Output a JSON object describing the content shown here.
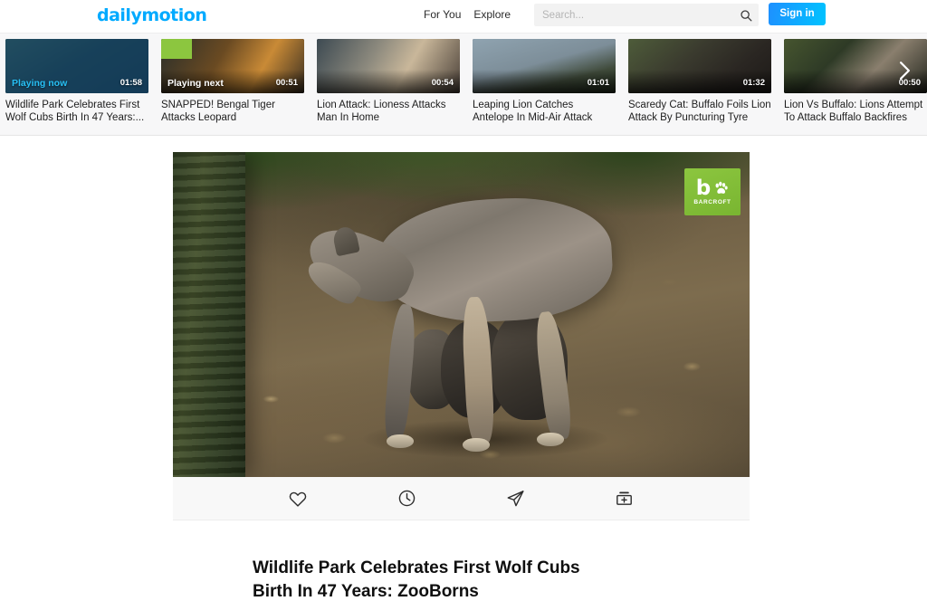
{
  "header": {
    "logo": "dailymotion",
    "nav": [
      {
        "label": "For You",
        "name": "nav-for-you"
      },
      {
        "label": "Explore",
        "name": "nav-explore"
      }
    ],
    "search": {
      "placeholder": "Search...",
      "value": "",
      "icon": "search-icon"
    },
    "signin_label": "Sign in",
    "accent_color": "#00aaff",
    "signin_gradient_from": "#1e90ff",
    "signin_gradient_to": "#00c3ff"
  },
  "strip": {
    "next_arrow_icon": "chevron-right-icon",
    "items": [
      {
        "title": "Wildlife Park Celebrates First Wolf Cubs Birth In 47 Years:...",
        "duration": "01:58",
        "badge": "Playing now",
        "state": "now"
      },
      {
        "title": "SNAPPED! Bengal Tiger Attacks Leopard",
        "duration": "00:51",
        "badge": "Playing next",
        "state": "next"
      },
      {
        "title": "Lion Attack: Lioness Attacks Man In Home",
        "duration": "00:54",
        "badge": "",
        "state": "idle"
      },
      {
        "title": "Leaping Lion Catches Antelope In Mid-Air Attack",
        "duration": "01:01",
        "badge": "",
        "state": "idle"
      },
      {
        "title": "Scaredy Cat: Buffalo Foils Lion Attack By Puncturing Tyre",
        "duration": "01:32",
        "badge": "",
        "state": "idle"
      },
      {
        "title": "Lion Vs Buffalo: Lions Attempt To Attack Buffalo Backfires",
        "duration": "00:50",
        "badge": "",
        "state": "idle"
      }
    ]
  },
  "player": {
    "watermark": {
      "mark": "b",
      "text": "BARCROFT",
      "color": "#8cc63f"
    },
    "actions": [
      {
        "name": "favorite-button",
        "icon": "heart-icon"
      },
      {
        "name": "watch-later-button",
        "icon": "clock-icon"
      },
      {
        "name": "share-button",
        "icon": "send-icon"
      },
      {
        "name": "add-to-playlist-button",
        "icon": "add-to-playlist-icon"
      }
    ]
  },
  "video": {
    "title": "Wildlife Park Celebrates First Wolf Cubs Birth In 47 Years: ZooBorns"
  }
}
